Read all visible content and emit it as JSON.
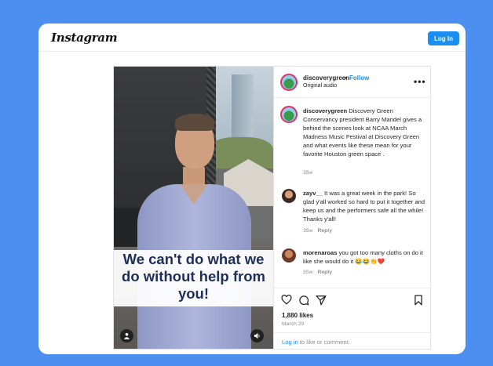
{
  "header": {
    "logo": "Instagram",
    "login_button": "Log In"
  },
  "post": {
    "caption_overlay": "We can't do what we do without help from you!",
    "author": {
      "username": "discoverygreen",
      "separator": "•",
      "follow": "Follow",
      "audio": "Original audio"
    },
    "caption": {
      "username": "discoverygreen",
      "text": "Discovery Green Conservancy president Barry Mandel gives a behind the scenes look at NCAA March Madness Music Festival at Discovery Green and what events like these mean for your favorite Houston green space .",
      "time": "35w"
    },
    "comments": [
      {
        "username": "zayv__",
        "text": "It was a great week in the park! So glad y'all worked so hard to put it together and keep us and the performers safe all the while! Thanks y'all!",
        "time": "35w",
        "reply": "Reply"
      },
      {
        "username": "morenaroas",
        "text": "you got too many cloths on do it like she would do it 😂😂👏❤️",
        "time": "35w",
        "reply": "Reply"
      }
    ],
    "likes": "1,880 likes",
    "date": "March 29",
    "login_prompt": {
      "link": "Log in",
      "text": " to like or comment."
    }
  },
  "icons": [
    "heart-icon",
    "comment-icon",
    "share-icon",
    "bookmark-icon",
    "more-options-icon",
    "user-tag-icon",
    "sound-icon"
  ],
  "colors": {
    "background": "#4d8ff0",
    "accent": "#1b8ef2",
    "caption_text": "#1e2f57"
  }
}
